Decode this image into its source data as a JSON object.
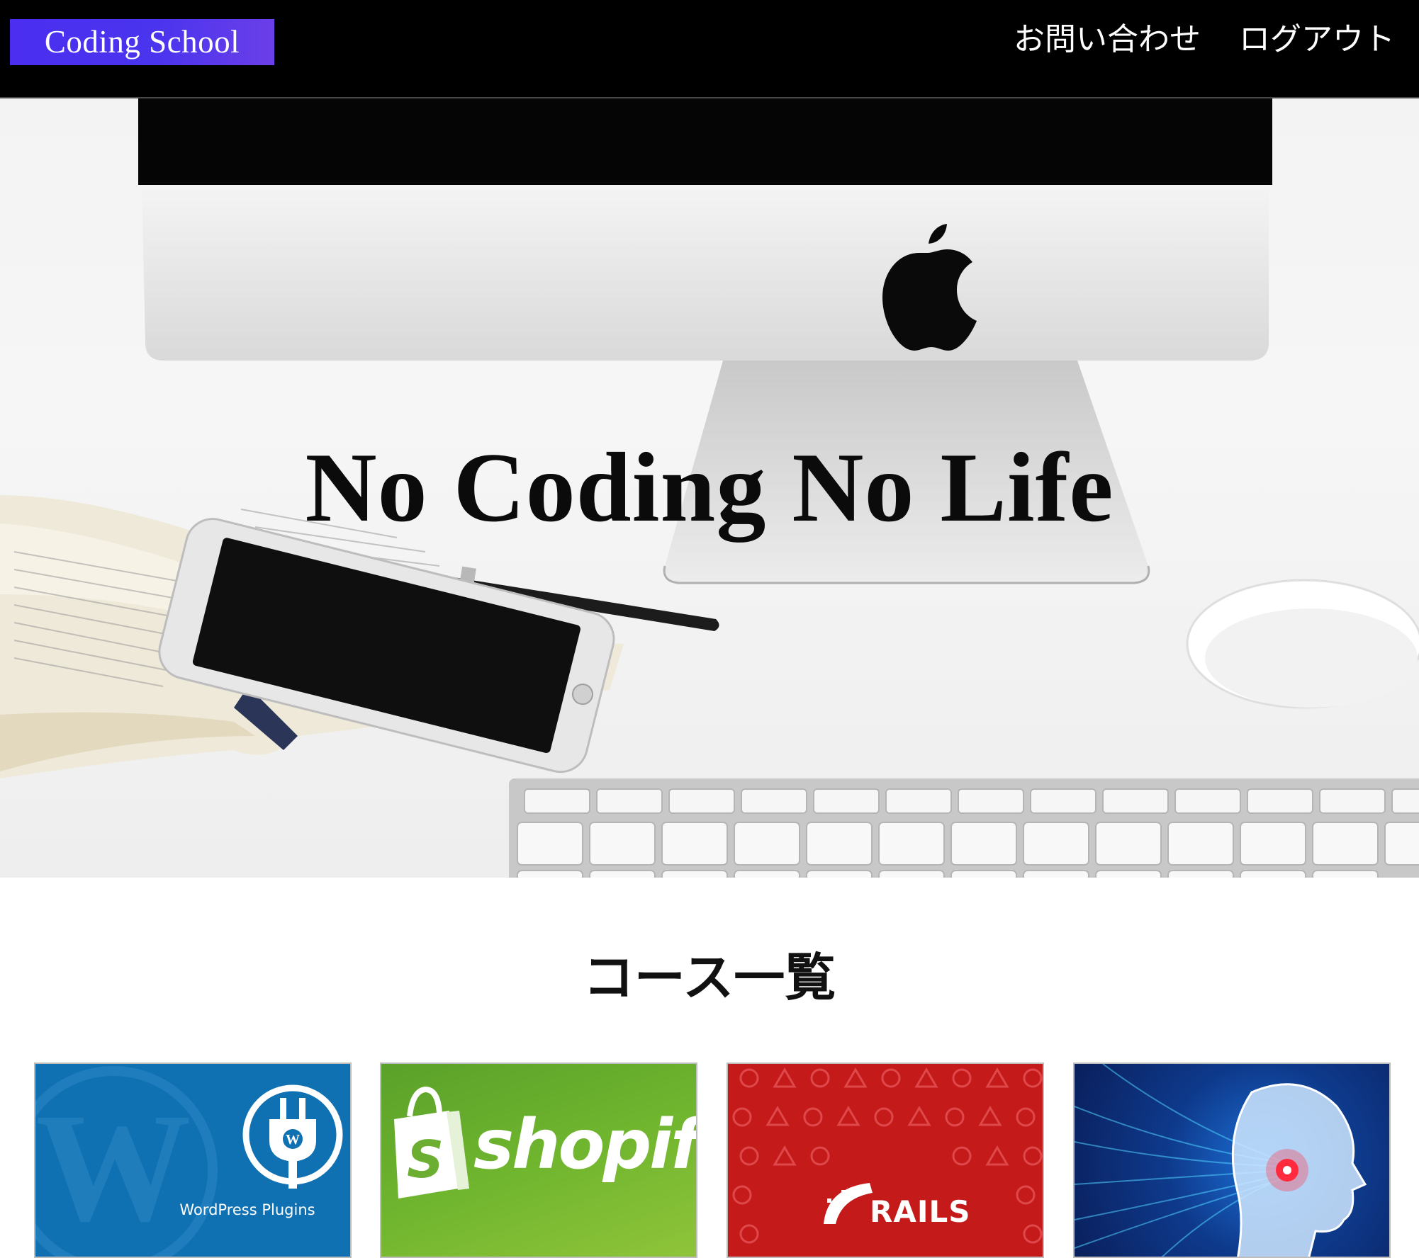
{
  "header": {
    "logo_text": "Coding School",
    "nav": [
      {
        "label": "お問い合わせ"
      },
      {
        "label": "ログアウト"
      }
    ]
  },
  "hero": {
    "title": "No Coding No Life",
    "image": "desk-with-imac-phone-book-keyboard"
  },
  "courses": {
    "heading": "コース一覧",
    "cards": [
      {
        "image": "wordpress-plugins",
        "caption": "WordPress Plugins"
      },
      {
        "image": "shopify",
        "caption": "shopify"
      },
      {
        "image": "rails",
        "caption": "RAILS"
      },
      {
        "image": "ai-head"
      }
    ]
  },
  "colors": {
    "header_bg": "#000000",
    "logo_gradient_start": "#4b2ef0",
    "logo_gradient_end": "#6b3fe8",
    "wordpress_blue": "#0f70b2",
    "shopify_green": "#6fb52e",
    "rails_red": "#c51a1a",
    "ai_blue": "#0e3a8c"
  }
}
